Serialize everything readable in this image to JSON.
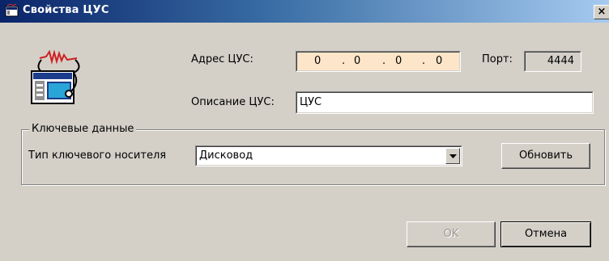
{
  "window": {
    "title": "Свойства ЦУС",
    "close_label": "×"
  },
  "fields": {
    "address_label": "Адрес ЦУС:",
    "address_octets": [
      "0",
      "0",
      "0",
      "0"
    ],
    "address_separator": ".",
    "port_label": "Порт:",
    "port_value": "4444",
    "description_label": "Описание ЦУС:",
    "description_value": "ЦУС"
  },
  "key_group": {
    "legend": "Ключевые данные",
    "carrier_label": "Тип ключевого носителя",
    "carrier_selected": "Дисковод",
    "refresh_label": "Обновить"
  },
  "buttons": {
    "ok_label": "OK",
    "cancel_label": "Отмена"
  },
  "colors": {
    "title_bar_start": "#0a246a",
    "title_bar_end": "#a6caf0",
    "address_field_bg": "#fde5c9",
    "window_bg": "#d4d0c8"
  },
  "icons": {
    "title": "window-app-icon",
    "main": "network-center-icon"
  }
}
